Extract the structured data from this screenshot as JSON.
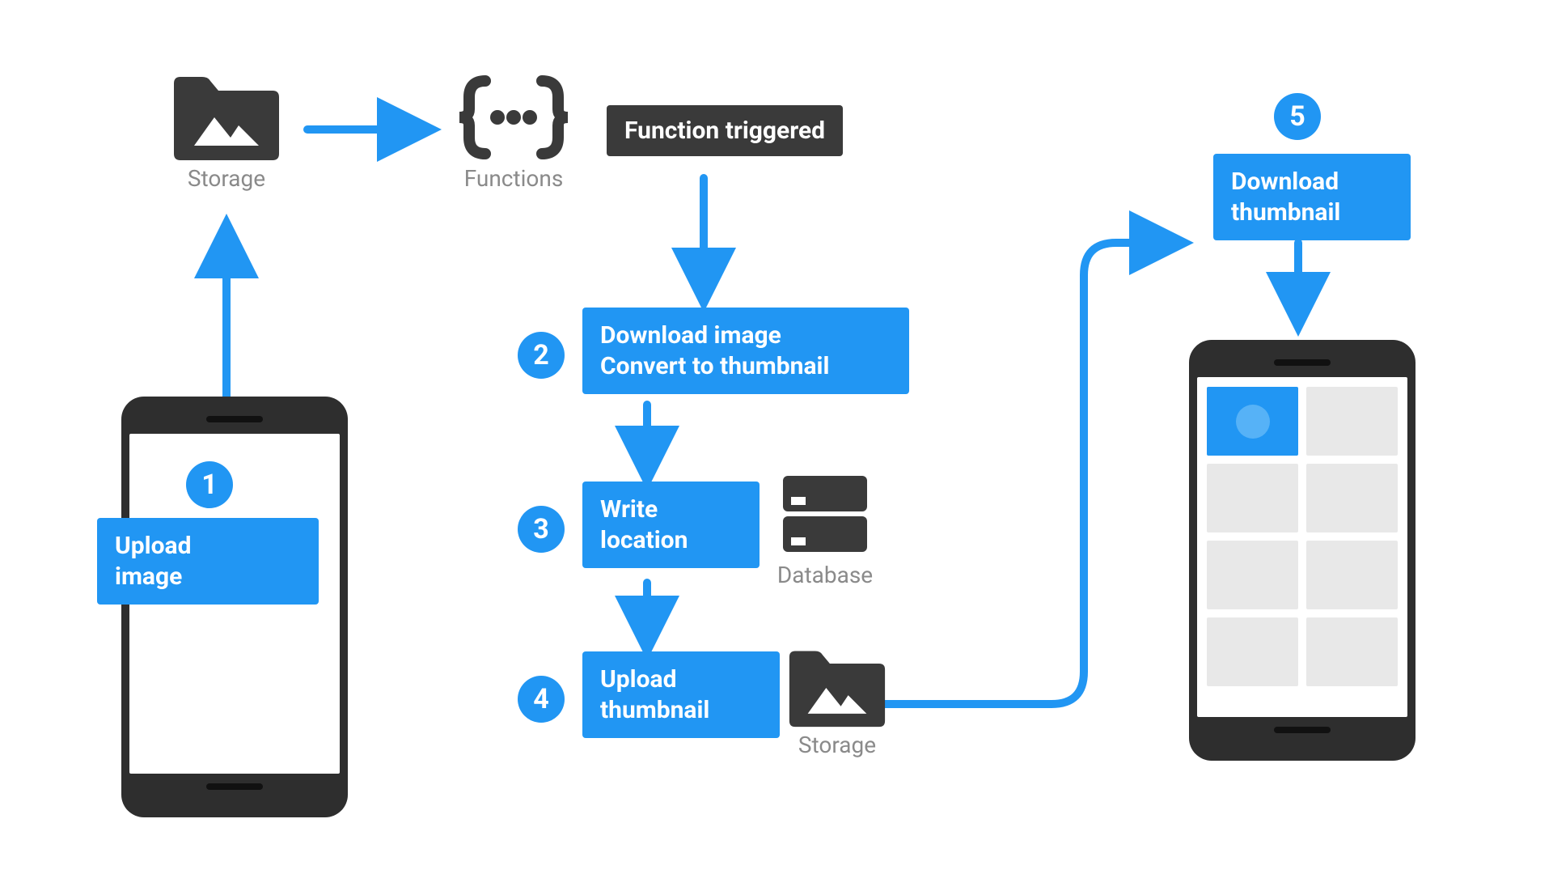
{
  "colors": {
    "accent": "#2196F3",
    "dark": "#3A3A3A",
    "muted": "#8a8a8a"
  },
  "icons": {
    "storage_top": {
      "name": "folder-image-icon",
      "label": "Storage"
    },
    "functions": {
      "name": "functions-icon",
      "label": "Functions"
    },
    "database": {
      "name": "database-icon",
      "label": "Database"
    },
    "storage_bot": {
      "name": "folder-image-icon",
      "label": "Storage"
    }
  },
  "boxes": {
    "trigger": "Function triggered",
    "upload": "Upload image",
    "download": "Download thumbnail"
  },
  "steps": {
    "1": {
      "num": "1",
      "label": "Upload image"
    },
    "2": {
      "num": "2",
      "line1": "Download image",
      "line2": "Convert to thumbnail"
    },
    "3": {
      "num": "3",
      "line1": "Write",
      "line2": "location"
    },
    "4": {
      "num": "4",
      "line1": "Upload",
      "line2": "thumbnail"
    },
    "5": {
      "num": "5",
      "label": "Download thumbnail"
    }
  }
}
